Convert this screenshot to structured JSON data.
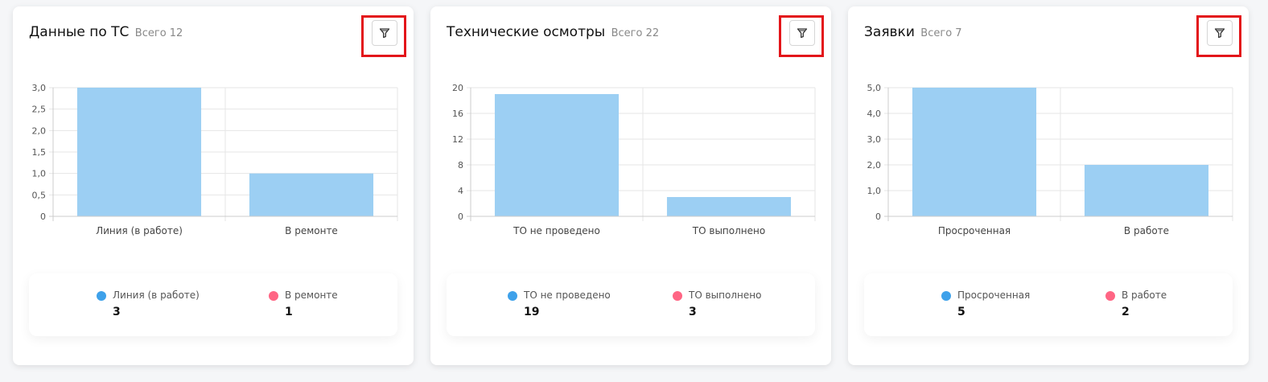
{
  "colors": {
    "bar": "#9ccff3",
    "grid": "#e6e6e6",
    "axis": "#cccccc",
    "legend_blue": "#3ea1ea",
    "legend_pink": "#ff6584",
    "highlight": "#e3151a"
  },
  "filter_icon": "funnel-icon",
  "cards": [
    {
      "title": "Данные по ТС",
      "total": "Всего 12",
      "legend": [
        {
          "label": "Линия (в работе)",
          "value": "3"
        },
        {
          "label": "В ремонте",
          "value": "1"
        }
      ]
    },
    {
      "title": "Технические осмотры",
      "total": "Всего 22",
      "legend": [
        {
          "label": "ТО не проведено",
          "value": "19"
        },
        {
          "label": "ТО выполнено",
          "value": "3"
        }
      ]
    },
    {
      "title": "Заявки",
      "total": "Всего 7",
      "legend": [
        {
          "label": "Просроченная",
          "value": "5"
        },
        {
          "label": "В работе",
          "value": "2"
        }
      ]
    }
  ],
  "chart_data": [
    {
      "type": "bar",
      "title": "Данные по ТС",
      "categories": [
        "Линия (в работе)",
        "В ремонте"
      ],
      "values": [
        3,
        1
      ],
      "ylim": [
        0,
        3
      ],
      "yticks": [
        0,
        0.5,
        1.0,
        1.5,
        2.0,
        2.5,
        3.0
      ],
      "ytick_labels": [
        "0",
        "0,5",
        "1,0",
        "1,5",
        "2,0",
        "2,5",
        "3,0"
      ],
      "grid": true
    },
    {
      "type": "bar",
      "title": "Технические осмотры",
      "categories": [
        "ТО не проведено",
        "ТО выполнено"
      ],
      "values": [
        19,
        3
      ],
      "ylim": [
        0,
        20
      ],
      "yticks": [
        0,
        4,
        8,
        12,
        16,
        20
      ],
      "ytick_labels": [
        "0",
        "4",
        "8",
        "12",
        "16",
        "20"
      ],
      "grid": true
    },
    {
      "type": "bar",
      "title": "Заявки",
      "categories": [
        "Просроченная",
        "В работе"
      ],
      "values": [
        5,
        2
      ],
      "ylim": [
        0,
        5
      ],
      "yticks": [
        0,
        1,
        2,
        3,
        4,
        5
      ],
      "ytick_labels": [
        "0",
        "1,0",
        "2,0",
        "3,0",
        "4,0",
        "5,0"
      ],
      "grid": true
    }
  ]
}
